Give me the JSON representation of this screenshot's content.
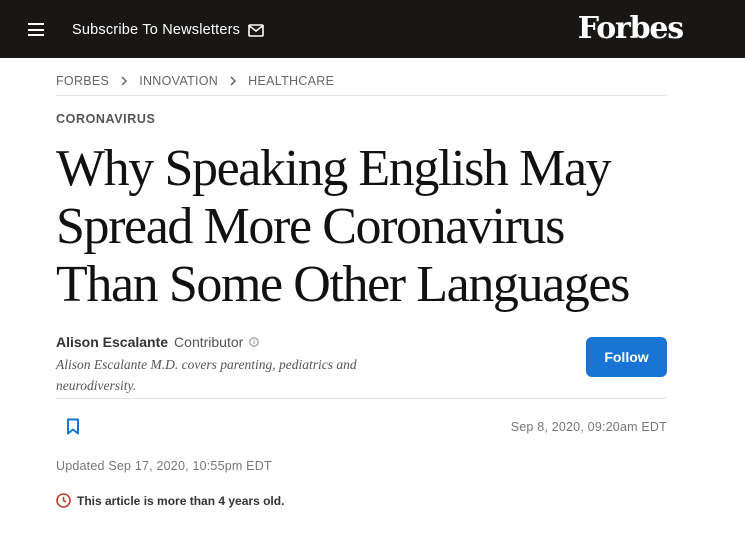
{
  "header": {
    "subscribe_label": "Subscribe To Newsletters",
    "logo_text": "Forbes",
    "menu_icon": "hamburger-menu-icon",
    "mail_icon": "envelope-icon"
  },
  "breadcrumb": [
    "FORBES",
    "INNOVATION",
    "HEALTHCARE"
  ],
  "section_tag": "CORONAVIRUS",
  "headline": "Why Speaking English May Spread More Coronavirus Than Some Other Languages",
  "author": {
    "name": "Alison Escalante",
    "role": "Contributor",
    "bio": "Alison Escalante M.D. covers parenting, pediatrics and neurodiversity."
  },
  "follow_label": "Follow",
  "published": "Sep 8, 2020, 09:20am EDT",
  "updated": "Updated Sep 17, 2020, 10:55pm EDT",
  "age_notice": "This article is more than 4 years old.",
  "colors": {
    "topbar": "#181716",
    "follow_button": "#1a74d6",
    "bookmark": "#1a74d6",
    "notice_icon": "#c0392b"
  }
}
